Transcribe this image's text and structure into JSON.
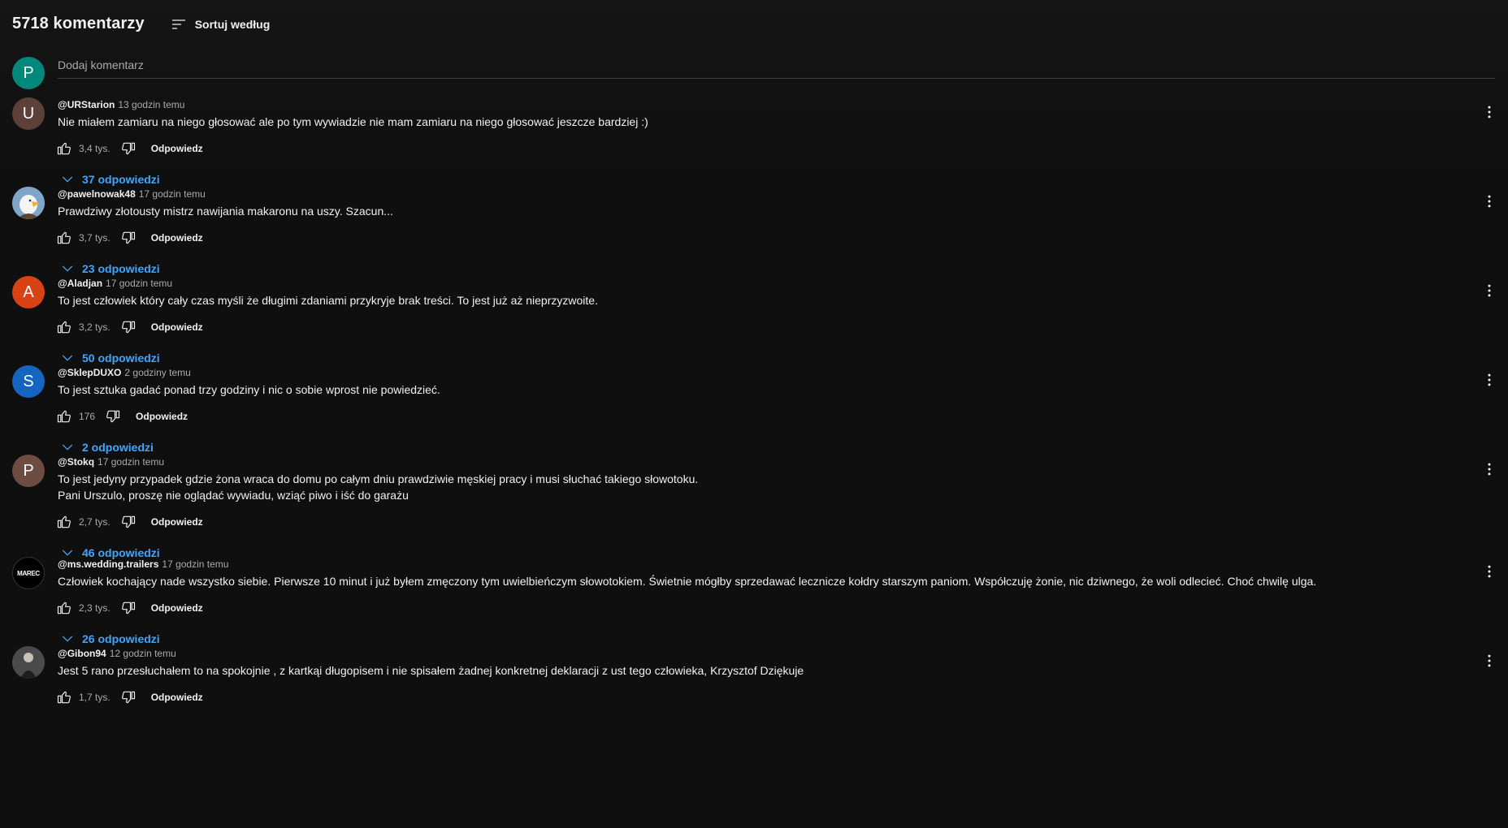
{
  "header": {
    "count_label": "5718 komentarzy",
    "sort_label": "Sortuj według"
  },
  "add_comment": {
    "avatar_letter": "P",
    "avatar_color": "#00897b",
    "placeholder": "Dodaj komentarz"
  },
  "comments": [
    {
      "author": "@URStarion",
      "time": "13 godzin temu",
      "avatar_letter": "U",
      "avatar_color": "#5d4037",
      "lines": [
        "Nie miałem zamiaru na niego głosować ale po tym wywiadzie nie mam zamiaru na niego głosować jeszcze bardziej :)"
      ],
      "likes": "3,4 tys.",
      "reply_label": "Odpowiedz",
      "replies_label": "37 odpowiedzi"
    },
    {
      "author": "@pawelnowak48",
      "time": "17 godzin temu",
      "avatar_letter": "",
      "avatar_color": "#4f7fa8",
      "lines": [
        "Prawdziwy złotousty mistrz nawijania makaronu na uszy. Szacun..."
      ],
      "likes": "3,7 tys.",
      "reply_label": "Odpowiedz",
      "replies_label": "23 odpowiedzi"
    },
    {
      "author": "@Aladjan",
      "time": "17 godzin temu",
      "avatar_letter": "A",
      "avatar_color": "#d84315",
      "lines": [
        "To jest człowiek który cały czas myśli że długimi zdaniami przykryje brak treści. To jest już aż nieprzyzwoite."
      ],
      "likes": "3,2 tys.",
      "reply_label": "Odpowiedz",
      "replies_label": "50 odpowiedzi"
    },
    {
      "author": "@SklepDUXO",
      "time": "2 godziny temu",
      "avatar_letter": "S",
      "avatar_color": "#1565c0",
      "lines": [
        "To jest sztuka gadać ponad trzy godziny i nic o sobie wprost nie powiedzieć."
      ],
      "likes": "176",
      "reply_label": "Odpowiedz",
      "replies_label": "2 odpowiedzi"
    },
    {
      "author": "@Stokq",
      "time": "17 godzin temu",
      "avatar_letter": "P",
      "avatar_color": "#6d4c41",
      "lines": [
        "To jest jedyny przypadek gdzie żona wraca do domu po całym dniu prawdziwie męskiej pracy i musi słuchać takiego słowotoku.",
        "Pani Urszulo, proszę nie oglądać wywiadu, wziąć piwo i iść do garażu"
      ],
      "likes": "2,7 tys.",
      "reply_label": "Odpowiedz",
      "replies_label": "46 odpowiedzi"
    },
    {
      "author": "@ms.wedding.trailers",
      "time": "17 godzin temu",
      "avatar_letter": "",
      "avatar_color": "#000000",
      "avatar_logo": "MAREC",
      "lines": [
        "Człowiek kochający nade wszystko siebie. Pierwsze 10 minut i już byłem zmęczony tym uwielbieńczym słowotokiem. Świetnie mógłby sprzedawać lecznicze kołdry starszym paniom. Współczuję żonie, nic dziwnego, że woli odlecieć. Choć chwilę ulga."
      ],
      "likes": "2,3 tys.",
      "reply_label": "Odpowiedz",
      "replies_label": "26 odpowiedzi"
    },
    {
      "author": "@Gibon94",
      "time": "12 godzin temu",
      "avatar_letter": "",
      "avatar_color": "#3a3a3a",
      "lines": [
        "Jest 5 rano przesłuchałem to na spokojnie , z kartkąi długopisem i nie spisałem żadnej konkretnej deklaracji z ust tego człowieka, Krzysztof Dziękuje"
      ],
      "likes": "1,7 tys.",
      "reply_label": "Odpowiedz",
      "replies_label": ""
    }
  ]
}
